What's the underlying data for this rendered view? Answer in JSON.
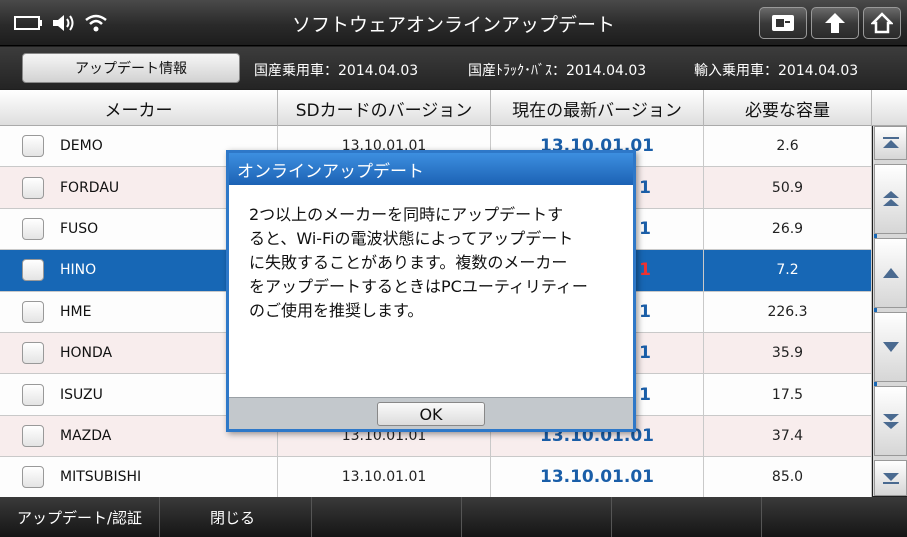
{
  "header": {
    "title": "ソフトウェアオンラインアップデート",
    "status_icons": [
      "battery-icon",
      "volume-icon",
      "wifi-icon"
    ],
    "buttons": [
      "screen-icon",
      "back-icon",
      "home-icon"
    ]
  },
  "info_bar": {
    "update_info_button": "アップデート情報",
    "domestic_car": "国産乗用車：2014.04.03",
    "domestic_truck": "国産ﾄﾗｯｸ･ﾊﾞｽ：2014.04.03",
    "import_car": "輸入乗用車：2014.04.03"
  },
  "table": {
    "columns": [
      "メーカー",
      "SDカードのバージョン",
      "現在の最新バージョン",
      "必要な容量"
    ],
    "rows": [
      {
        "maker": "DEMO",
        "sd": "13.10.01.01",
        "latest": "13.10.01.01",
        "size": "2.6"
      },
      {
        "maker": "FORDAU",
        "sd": "",
        "latest": "1",
        "size": "50.9"
      },
      {
        "maker": "FUSO",
        "sd": "",
        "latest": "1",
        "size": "26.9"
      },
      {
        "maker": "HINO",
        "sd": "",
        "latest": "1",
        "size": "7.2",
        "selected": true
      },
      {
        "maker": "HME",
        "sd": "",
        "latest": "1",
        "size": "226.3"
      },
      {
        "maker": "HONDA",
        "sd": "",
        "latest": "1",
        "size": "35.9"
      },
      {
        "maker": "ISUZU",
        "sd": "",
        "latest": "1",
        "size": "17.5"
      },
      {
        "maker": "MAZDA",
        "sd": "13.10.01.01",
        "latest": "13.10.01.01",
        "size": "37.4"
      },
      {
        "maker": "MITSUBISHI",
        "sd": "13.10.01.01",
        "latest": "13.10.01.01",
        "size": "85.0"
      }
    ]
  },
  "dialog": {
    "title": "オンラインアップデート",
    "lines": [
      "2つ以上のメーカーを同時にアップデートす",
      "ると、Wi-Fiの電波状態によってアップデート",
      "に失敗することがあります。複数のメーカー",
      "をアップデートするときはPCユーティリティー",
      "のご使用を推奨します。"
    ],
    "ok_label": "OK"
  },
  "bottom_bar": {
    "update_auth": "アップデート/認証",
    "close": "閉じる"
  },
  "colors": {
    "selected_row": "#1767b5",
    "latest_version": "#1a5ea8",
    "dialog_title": "#2e78c8"
  }
}
